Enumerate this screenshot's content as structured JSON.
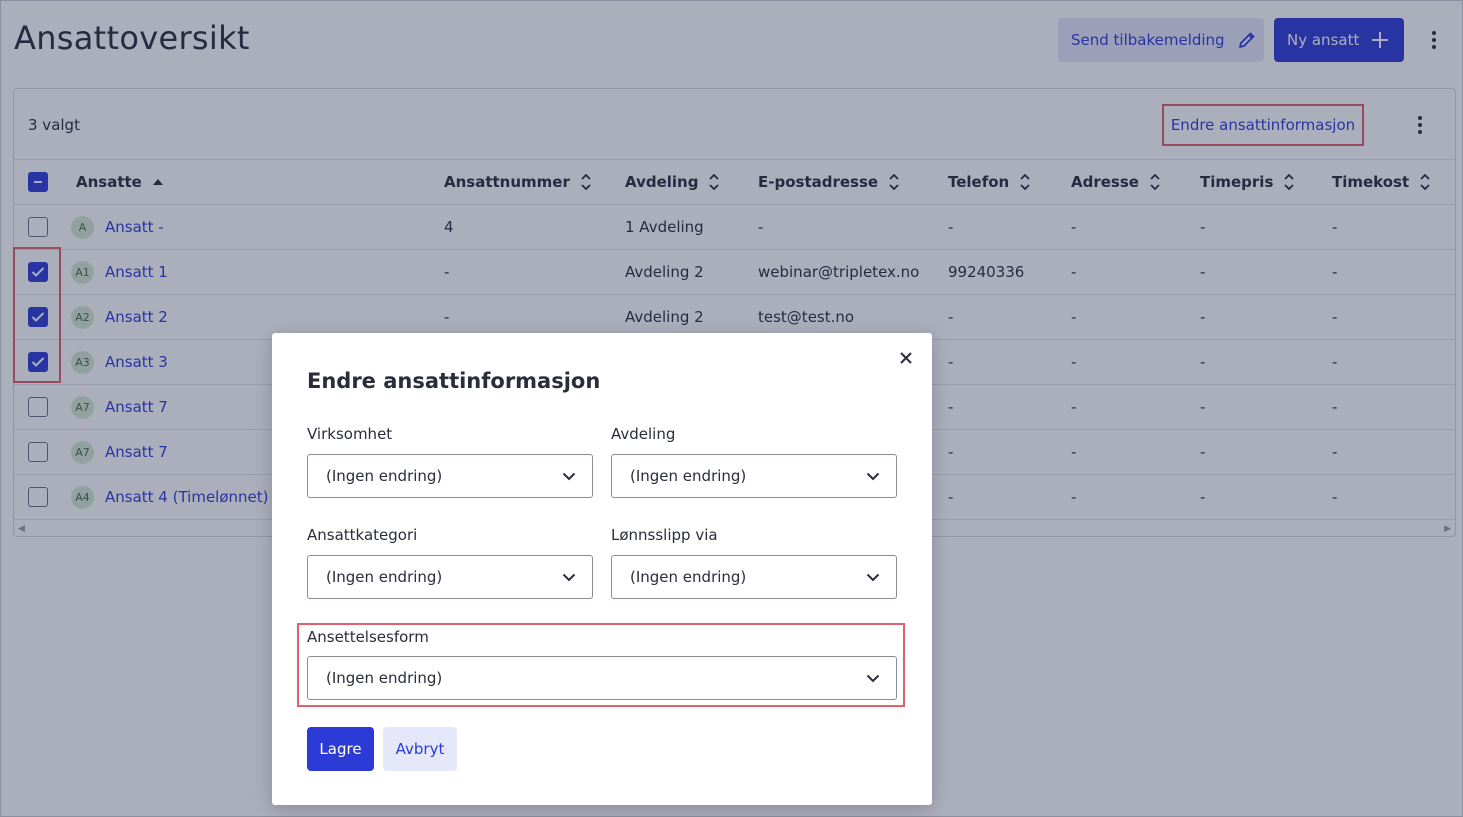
{
  "page": {
    "title": "Ansattoversikt",
    "feedback_button": "Send tilbakemelding",
    "new_button": "Ny ansatt"
  },
  "toolbar": {
    "selected_count": "3 valgt",
    "edit_link": "Endre ansattinformasjon"
  },
  "table": {
    "columns": [
      "Ansatte",
      "Ansattnummer",
      "Avdeling",
      "E-postadresse",
      "Telefon",
      "Adresse",
      "Timepris",
      "Timekost"
    ],
    "rows": [
      {
        "checked": false,
        "initials": "A",
        "name": "Ansatt -",
        "number": "4",
        "department": "1 Avdeling",
        "email": "-",
        "phone": "-",
        "address": "-",
        "rate": "-",
        "cost": "-"
      },
      {
        "checked": true,
        "initials": "A1",
        "name": "Ansatt 1",
        "number": "-",
        "department": "Avdeling 2",
        "email": "webinar@tripletex.no",
        "phone": "99240336",
        "address": "-",
        "rate": "-",
        "cost": "-"
      },
      {
        "checked": true,
        "initials": "A2",
        "name": "Ansatt 2",
        "number": "-",
        "department": "Avdeling 2",
        "email": "test@test.no",
        "phone": "-",
        "address": "-",
        "rate": "-",
        "cost": "-"
      },
      {
        "checked": true,
        "initials": "A3",
        "name": "Ansatt 3",
        "number": "",
        "department": "",
        "email": "",
        "phone": "-",
        "address": "-",
        "rate": "-",
        "cost": "-"
      },
      {
        "checked": false,
        "initials": "A7",
        "name": "Ansatt 7",
        "number": "",
        "department": "",
        "email": "",
        "phone": "-",
        "address": "-",
        "rate": "-",
        "cost": "-"
      },
      {
        "checked": false,
        "initials": "A7",
        "name": "Ansatt 7",
        "number": "",
        "department": "",
        "email": "",
        "phone": "-",
        "address": "-",
        "rate": "-",
        "cost": "-"
      },
      {
        "checked": false,
        "initials": "A4",
        "name": "Ansatt 4 (Timelønnet)",
        "number": "",
        "department": "",
        "email": "",
        "phone": "-",
        "address": "-",
        "rate": "-",
        "cost": "-"
      }
    ]
  },
  "modal": {
    "title": "Endre ansattinformasjon",
    "fields": {
      "virksomhet": {
        "label": "Virksomhet",
        "value": "(Ingen endring)"
      },
      "avdeling": {
        "label": "Avdeling",
        "value": "(Ingen endring)"
      },
      "ansattkategori": {
        "label": "Ansattkategori",
        "value": "(Ingen endring)"
      },
      "lonnsslipp": {
        "label": "Lønnsslipp via",
        "value": "(Ingen endring)"
      },
      "ansettelsesform": {
        "label": "Ansettelsesform",
        "value": "(Ingen endring)"
      }
    },
    "save_button": "Lagre",
    "cancel_button": "Avbryt"
  },
  "colors": {
    "primary": "#2d3bd6",
    "primary_light": "#e5e7fa",
    "highlight": "#e0606d",
    "avatar_bg": "#d4ead4"
  }
}
